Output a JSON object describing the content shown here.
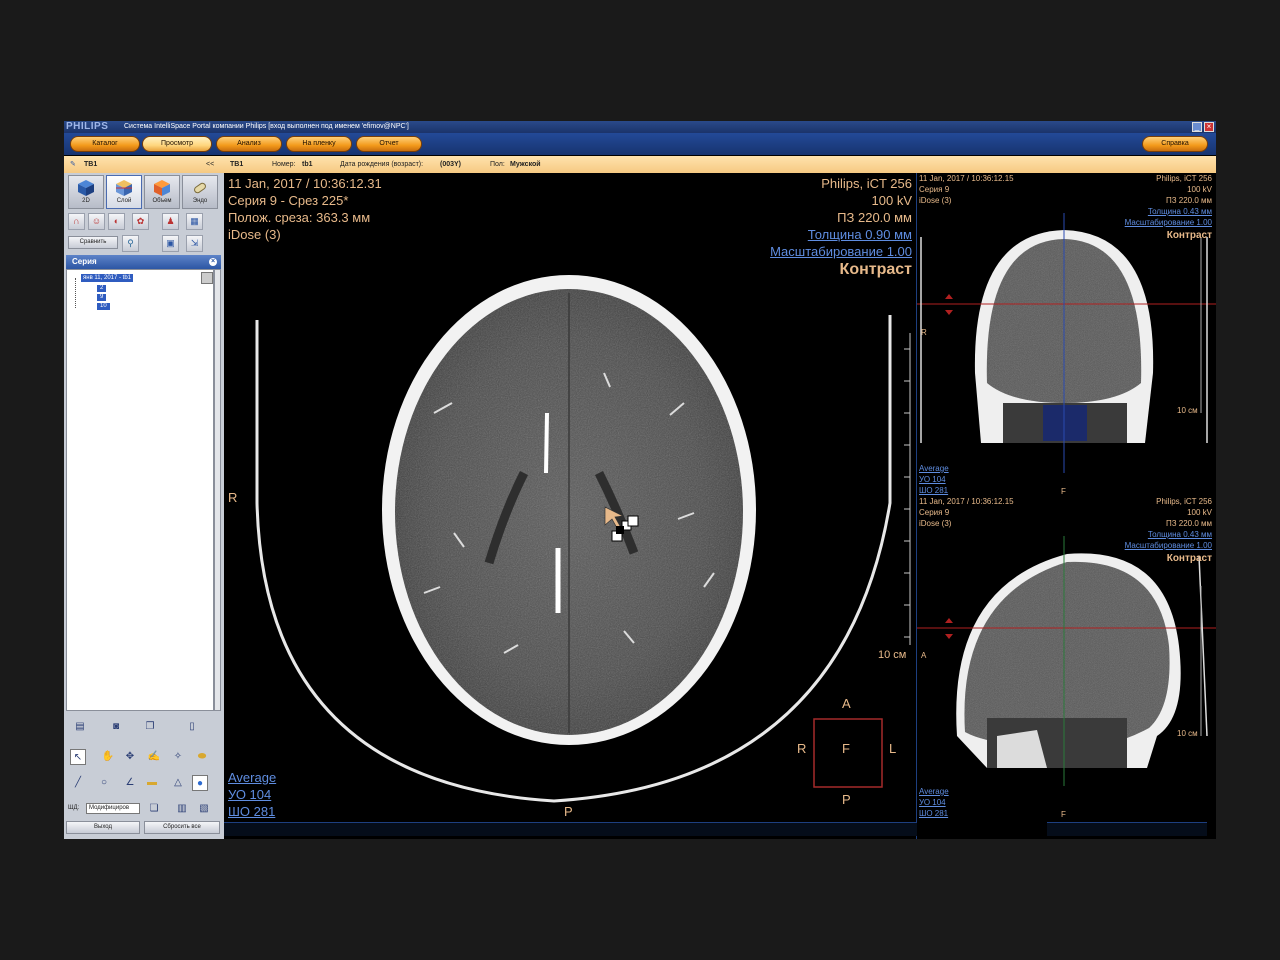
{
  "titlebar": {
    "logo": "PHILIPS",
    "title": "Система IntelliSpace Portal компании Philips [вход выполнен под именем 'efimov@NPC']"
  },
  "navbar": {
    "buttons": [
      "Каталог",
      "Просмотр",
      "Анализ",
      "На пленку",
      "Отчет"
    ],
    "help": "Справка"
  },
  "patient": {
    "tab_label": "ТВ1",
    "collapse": "<<",
    "name": "ТВ1",
    "number_label": "Номер:",
    "number": "tb1",
    "dob_label": "Дата рождения (возраст):",
    "dob": "(003Y)",
    "sex_label": "Пол:",
    "sex": "Мужской"
  },
  "left_panel": {
    "tabs": [
      "2D",
      "Слой",
      "Объем",
      "Эндо"
    ],
    "compare_button": "Сравнить",
    "series_header": "Серия",
    "tree_root": "янв 11, 2017 - tb1",
    "tree_items": [
      "2",
      "9",
      "10"
    ],
    "wl_label": "ШД:",
    "wl_value": "Модифициров",
    "exit_button": "Выход",
    "reset_button": "Сбросить все"
  },
  "main_view": {
    "date_time": "11 Jan, 2017 / 10:36:12.31",
    "series_slice": "Серия 9 - Срез 225*",
    "slice_position": "Полож. среза: 363.3 мм",
    "idose": "iDose (3)",
    "scanner": "Philips, iCT 256",
    "kv": "100 kV",
    "fov": "ПЗ 220.0 мм",
    "thickness": "Толщина 0.90 мм",
    "zoom": "Масштабирование 1.00",
    "preset": "Контраст",
    "orient_left": "R",
    "orient_bottom": "P",
    "scale_label": "10 см",
    "average": "Average",
    "wl_center": "УО   104",
    "wl_width": "ШО   281",
    "cube_top": "A",
    "cube_left": "R",
    "cube_center": "F",
    "cube_right": "L",
    "cube_bottom": "P"
  },
  "coronal_view": {
    "date_time": "11 Jan, 2017 / 10:36:12.15",
    "series": "Серия 9",
    "idose": "iDose (3)",
    "scanner": "Philips, iCT 256",
    "kv": "100 kV",
    "fov": "ПЗ 220.0 мм",
    "thickness": "Толщина 0.43 мм",
    "zoom": "Масштабирование 1.00",
    "preset": "Контраст",
    "orient_left": "R",
    "orient_bottom": "F",
    "scale_label": "10 см",
    "average": "Average",
    "wl_center": "УО   104",
    "wl_width": "ШО   281"
  },
  "sagittal_view": {
    "date_time": "11 Jan, 2017 / 10:36:12.15",
    "series": "Серия 9",
    "idose": "iDose (3)",
    "scanner": "Philips, iCT 256",
    "kv": "100 kV",
    "fov": "ПЗ 220.0 мм",
    "thickness": "Толщина 0.43 мм",
    "zoom": "Масштабирование 1.00",
    "preset": "Контраст",
    "orient_left": "A",
    "orient_bottom": "F",
    "scale_label": "10 см",
    "average": "Average",
    "wl_center": "УО   104",
    "wl_width": "ШО   281"
  },
  "colors": {
    "overlay_text": "#e7b98a",
    "link_text": "#5f8de0",
    "accent_orange": "#f39a1b",
    "title_blue": "#1b336a"
  }
}
